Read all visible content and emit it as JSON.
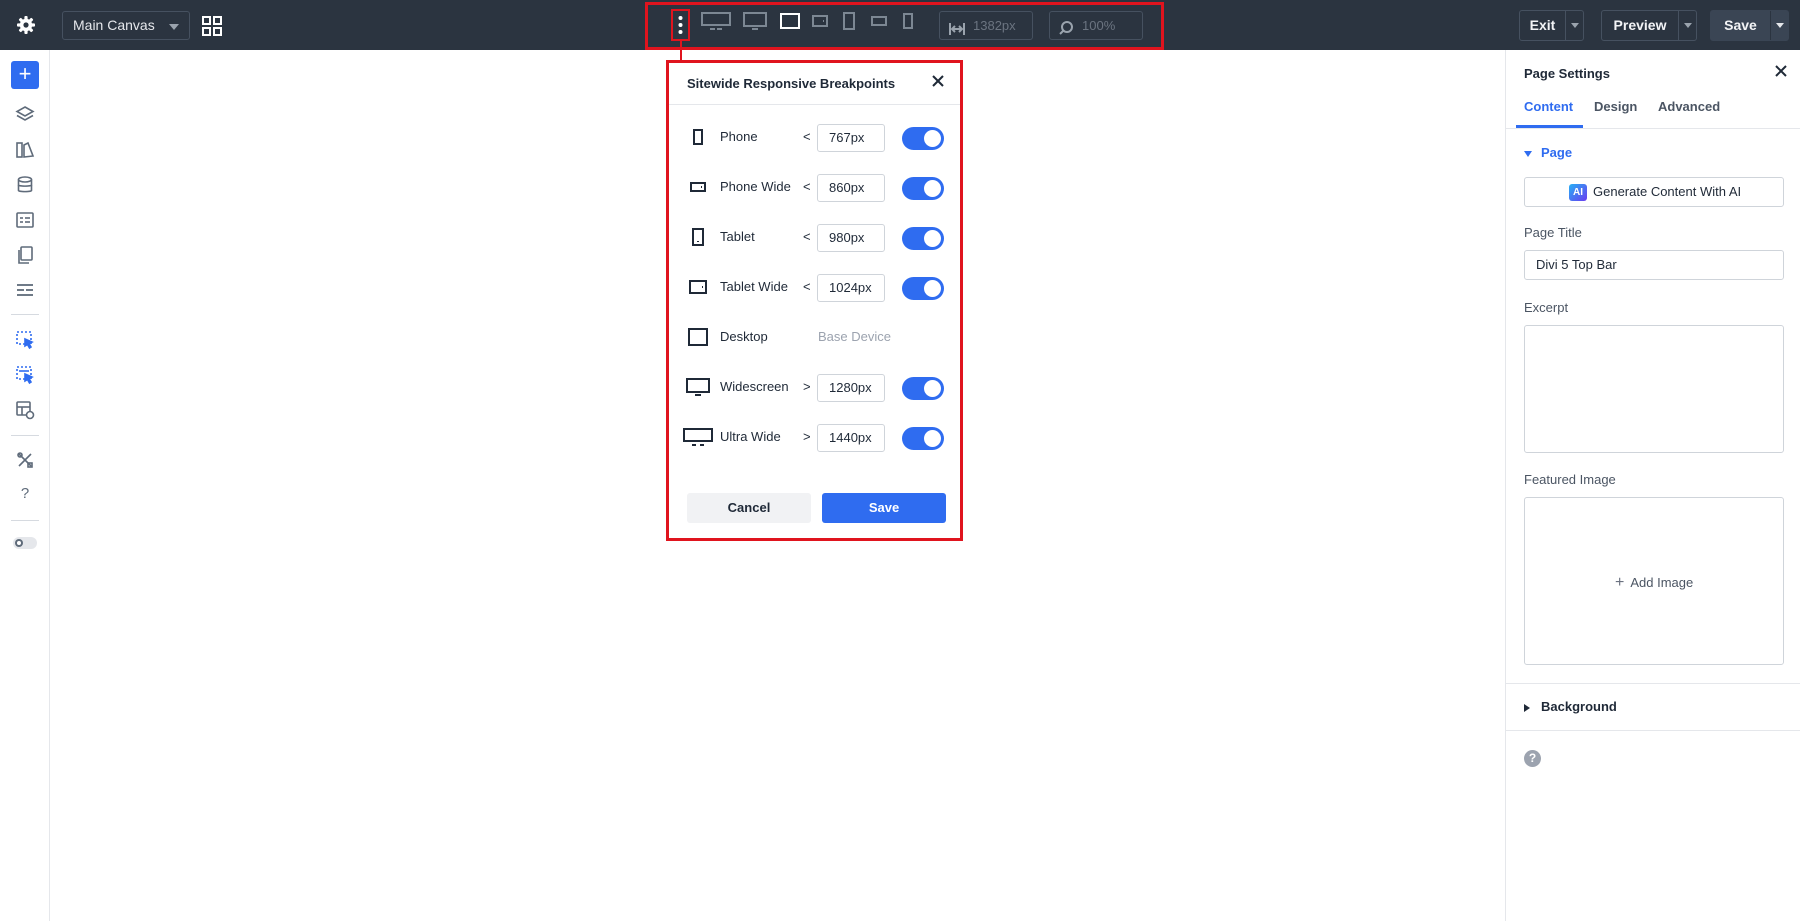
{
  "topbar": {
    "settings_icon": "gear-icon",
    "canvas_select": "Main Canvas",
    "layout_icon": "grid-icon",
    "width_value": "1382px",
    "zoom_value": "100%",
    "exit_label": "Exit",
    "preview_label": "Preview",
    "save_label": "Save",
    "device_icons": [
      "kebab-icon",
      "ultra-wide-icon",
      "widescreen-icon",
      "desktop-icon",
      "tablet-wide-icon",
      "tablet-icon",
      "phone-wide-icon",
      "phone-icon"
    ],
    "active_device": "Desktop"
  },
  "left_sidebar": {
    "add_label": "+",
    "icons": [
      "add-icon",
      "layers-icon",
      "design-library-icon",
      "database-icon",
      "form-icon",
      "pages-icon",
      "theme-builder-icon",
      "click-select-icon",
      "multi-select-icon",
      "view-settings-icon",
      "tools-icon",
      "help-icon",
      "dark-mode-toggle-icon"
    ]
  },
  "breakpoints_modal": {
    "title": "Sitewide Responsive Breakpoints",
    "rows": [
      {
        "name": "Phone",
        "operator": "<",
        "value": "767px",
        "enabled": true,
        "icon": "phone-icon"
      },
      {
        "name": "Phone Wide",
        "operator": "<",
        "value": "860px",
        "enabled": true,
        "icon": "phone-wide-icon"
      },
      {
        "name": "Tablet",
        "operator": "<",
        "value": "980px",
        "enabled": true,
        "icon": "tablet-icon"
      },
      {
        "name": "Tablet Wide",
        "operator": "<",
        "value": "1024px",
        "enabled": true,
        "icon": "tablet-wide-icon"
      },
      {
        "name": "Desktop",
        "operator": "",
        "value": "Base Device",
        "enabled": null,
        "icon": "desktop-icon"
      },
      {
        "name": "Widescreen",
        "operator": ">",
        "value": "1280px",
        "enabled": true,
        "icon": "widescreen-icon"
      },
      {
        "name": "Ultra Wide",
        "operator": ">",
        "value": "1440px",
        "enabled": true,
        "icon": "ultra-wide-icon"
      }
    ],
    "cancel_label": "Cancel",
    "save_label": "Save"
  },
  "page_settings": {
    "title": "Page Settings",
    "tabs": [
      {
        "label": "Content",
        "active": true
      },
      {
        "label": "Design",
        "active": false
      },
      {
        "label": "Advanced",
        "active": false
      }
    ],
    "page_section": "Page",
    "ai_button": "Generate Content With AI",
    "ai_badge": "AI",
    "page_title_label": "Page Title",
    "page_title_value": "Divi 5 Top Bar",
    "excerpt_label": "Excerpt",
    "excerpt_value": "",
    "featured_image_label": "Featured Image",
    "add_image_label": "Add Image",
    "background_section": "Background",
    "help_label": "?"
  },
  "colors": {
    "topbar_bg": "#2b3440",
    "accent": "#2f6cf0",
    "highlight_red": "#e0141e"
  }
}
